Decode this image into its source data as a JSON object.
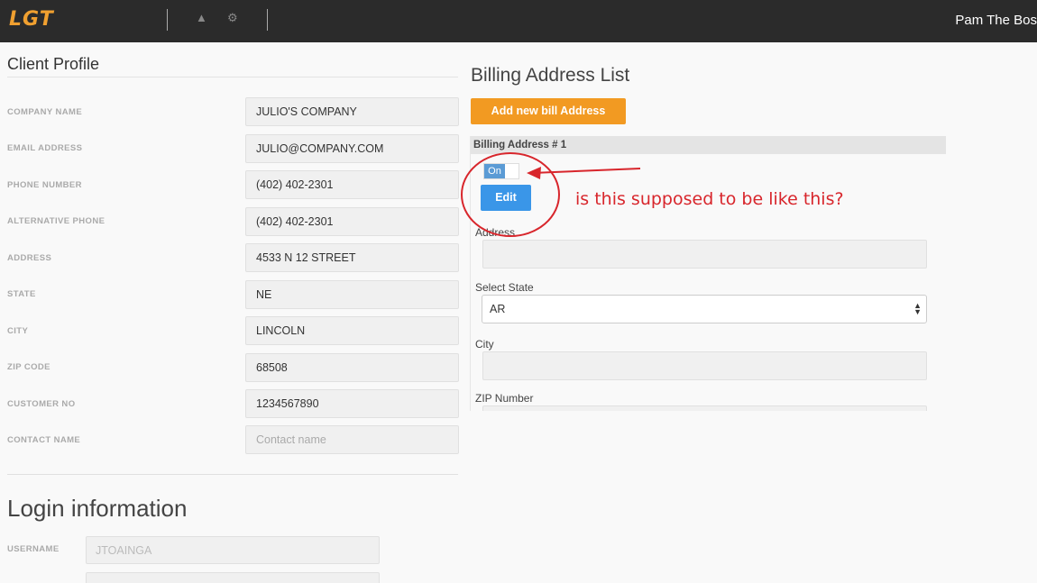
{
  "header": {
    "logo": "LGT",
    "user_name": "Pam The Bos"
  },
  "icons": {
    "bell": "bell-icon",
    "gear": "gear-icon"
  },
  "client_profile": {
    "title": "Client Profile",
    "fields": [
      {
        "label": "COMPANY NAME",
        "value": "JULIO'S COMPANY"
      },
      {
        "label": "EMAIL ADDRESS",
        "value": "JULIO@COMPANY.COM"
      },
      {
        "label": "PHONE NUMBER",
        "value": "(402) 402-2301"
      },
      {
        "label": "ALTERNATIVE PHONE",
        "value": "(402) 402-2301"
      },
      {
        "label": "ADDRESS",
        "value": "4533 N 12 STREET"
      },
      {
        "label": "STATE",
        "value": "NE"
      },
      {
        "label": "CITY",
        "value": "LINCOLN"
      },
      {
        "label": "ZIP CODE",
        "value": "68508"
      },
      {
        "label": "CUSTOMER NO",
        "value": "1234567890"
      },
      {
        "label": "CONTACT NAME",
        "placeholder": "Contact name"
      }
    ]
  },
  "login": {
    "title": "Login information",
    "username_label": "USERNAME",
    "username_placeholder": "JTOAINGA"
  },
  "billing": {
    "title": "Billing Address List",
    "add_button": "Add new bill Address",
    "item_header": "Billing Address # 1",
    "toggle_label": "On",
    "edit_button": "Edit",
    "address_label": "Address",
    "state_label": "Select State",
    "state_value": "AR",
    "city_label": "City",
    "zip_label": "ZIP Number"
  },
  "annotation": {
    "text": "is this supposed to be like this?",
    "color": "#d8262c"
  },
  "colors": {
    "topbar": "#2b2b2b",
    "logo": "#f0a030",
    "add_button": "#f29a22",
    "edit_button": "#3a96e8",
    "toggle_on": "#5b9bd5"
  }
}
